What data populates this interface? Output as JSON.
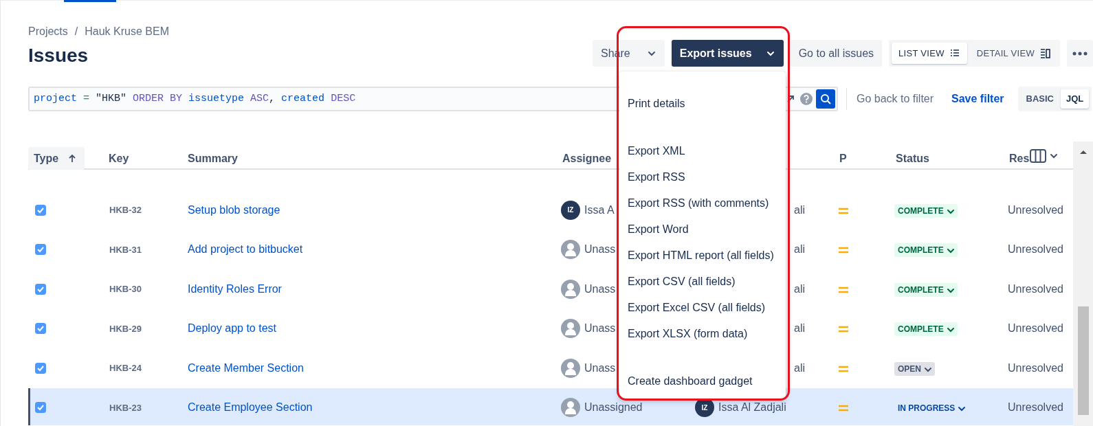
{
  "breadcrumbs": [
    "Projects",
    "Hauk Kruse BEM"
  ],
  "breadcrumb_separator": "/",
  "title": "Issues",
  "toolbar": {
    "share": "Share",
    "export": "Export issues",
    "go_all": "Go to all issues"
  },
  "views": [
    {
      "label": "LIST VIEW",
      "selected": true
    },
    {
      "label": "DETAIL VIEW",
      "selected": false
    }
  ],
  "jql": {
    "tokens": [
      {
        "text": "project ",
        "kind": "field"
      },
      {
        "text": "= ",
        "kind": "operator"
      },
      {
        "text": "\"HKB\" ",
        "kind": "value"
      },
      {
        "text": "ORDER BY ",
        "kind": "keyword"
      },
      {
        "text": "issuetype ",
        "kind": "field"
      },
      {
        "text": "ASC",
        "kind": "keyword"
      },
      {
        "text": ", ",
        "kind": "punct"
      },
      {
        "text": "created ",
        "kind": "field"
      },
      {
        "text": "DESC",
        "kind": "keyword"
      }
    ]
  },
  "filter_actions": {
    "back": "Go back to filter",
    "save": "Save filter"
  },
  "modes": [
    {
      "label": "BASIC",
      "selected": false
    },
    {
      "label": "JQL",
      "selected": true
    }
  ],
  "columns": [
    {
      "label": "Type",
      "sorted": true
    },
    {
      "label": "Key",
      "sorted": false
    },
    {
      "label": "Summary",
      "sorted": false
    },
    {
      "label": "Assignee",
      "sorted": false
    },
    {
      "label": "P",
      "sorted": false
    },
    {
      "label": "Status",
      "sorted": false
    },
    {
      "label": "Res",
      "sorted": false
    }
  ],
  "rows": [
    {
      "checked": true,
      "selected": false,
      "key": "HKB-32",
      "summary": "Setup blob storage",
      "assignee": {
        "name": "Issa A",
        "kind": "initials",
        "initials": "IZ"
      },
      "reporter": {
        "name": "ali"
      },
      "status": {
        "label": "COMPLETE",
        "kind": "done"
      },
      "resolution": "Unresolved"
    },
    {
      "checked": true,
      "selected": false,
      "key": "HKB-31",
      "summary": "Add project to bitbucket",
      "assignee": {
        "name": "Unass",
        "kind": "silhouette"
      },
      "reporter": {
        "name": "ali"
      },
      "status": {
        "label": "COMPLETE",
        "kind": "done"
      },
      "resolution": "Unresolved"
    },
    {
      "checked": true,
      "selected": false,
      "key": "HKB-30",
      "summary": "Identity Roles Error",
      "assignee": {
        "name": "Unass",
        "kind": "silhouette"
      },
      "reporter": {
        "name": "ali"
      },
      "status": {
        "label": "COMPLETE",
        "kind": "done"
      },
      "resolution": "Unresolved"
    },
    {
      "checked": true,
      "selected": false,
      "key": "HKB-29",
      "summary": "Deploy app to test",
      "assignee": {
        "name": "Unass",
        "kind": "silhouette"
      },
      "reporter": {
        "name": "ali"
      },
      "status": {
        "label": "COMPLETE",
        "kind": "done"
      },
      "resolution": "Unresolved"
    },
    {
      "checked": true,
      "selected": false,
      "key": "HKB-24",
      "summary": "Create Member Section",
      "assignee": {
        "name": "Unass",
        "kind": "silhouette"
      },
      "reporter": {
        "name": "ali"
      },
      "status": {
        "label": "OPEN",
        "kind": "todo"
      },
      "resolution": "Unresolved"
    },
    {
      "checked": true,
      "selected": true,
      "key": "HKB-23",
      "summary": "Create Employee Section",
      "assignee": {
        "name": "Unassigned",
        "kind": "silhouette"
      },
      "reporter": {
        "name": "Issa Al Zadjali",
        "kind": "initials",
        "initials": "IZ"
      },
      "status": {
        "label": "IN PROGRESS",
        "kind": "in_progress"
      },
      "resolution": "Unresolved"
    }
  ],
  "export_menu": {
    "groups": [
      [
        "Print details"
      ],
      [
        "Export XML",
        "Export RSS",
        "Export RSS (with comments)",
        "Export Word",
        "Export HTML report (all fields)",
        "Export CSV (all fields)",
        "Export Excel CSV (all fields)",
        "Export XLSX (form data)"
      ],
      [
        "Create dashboard gadget"
      ]
    ]
  }
}
